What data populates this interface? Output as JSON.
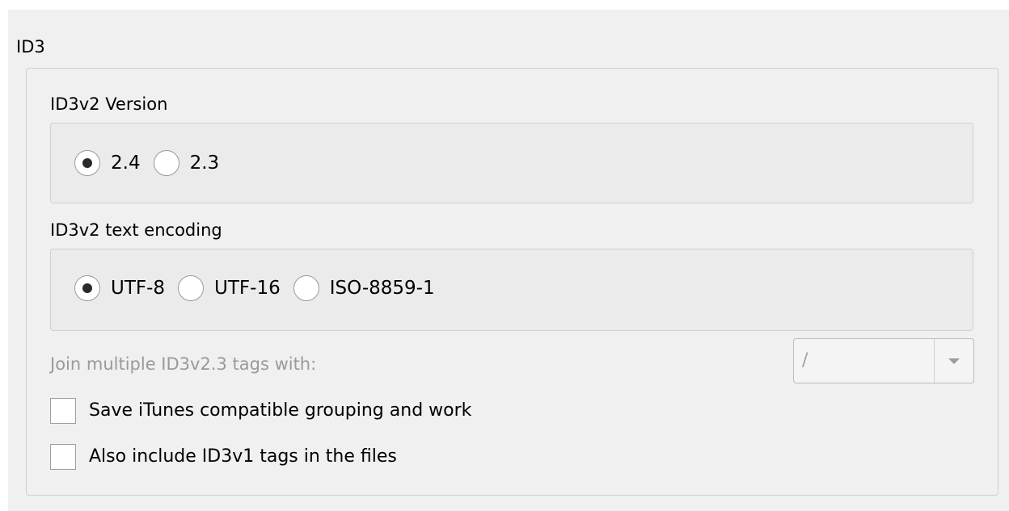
{
  "group": {
    "title": "ID3"
  },
  "version": {
    "title": "ID3v2 Version",
    "options": [
      {
        "label": "2.4",
        "checked": true
      },
      {
        "label": "2.3",
        "checked": false
      }
    ]
  },
  "encoding": {
    "title": "ID3v2 text encoding",
    "options": [
      {
        "label": "UTF-8",
        "checked": true
      },
      {
        "label": "UTF-16",
        "checked": false
      },
      {
        "label": "ISO-8859-1",
        "checked": false
      }
    ]
  },
  "join": {
    "label": "Join multiple ID3v2.3 tags with:",
    "value": "/",
    "enabled": false
  },
  "checkboxes": [
    {
      "label": "Save iTunes compatible grouping and work",
      "checked": false
    },
    {
      "label": "Also include ID3v1 tags in the files",
      "checked": false
    }
  ]
}
